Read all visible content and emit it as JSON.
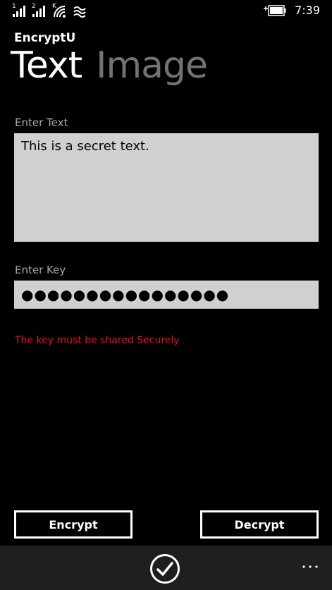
{
  "status_bar": {
    "sim1_label": "1",
    "sim2_label": "2",
    "data_indicator": "K",
    "time": "7:39",
    "icons": [
      "signal-bars-icon",
      "signal-bars-icon",
      "wifi-icon",
      "vibrate-icon",
      "battery-charging-icon"
    ]
  },
  "app": {
    "title": "EncryptU"
  },
  "pivot": {
    "tabs": [
      {
        "label": "Text",
        "active": true
      },
      {
        "label": "Image",
        "active": false
      }
    ]
  },
  "form": {
    "text_label": "Enter Text",
    "text_value": "This is a secret text.",
    "key_label": "Enter Key",
    "key_value": "●●●●●●●●●●●●●●●●",
    "warning": "The key must be shared Securely"
  },
  "buttons": {
    "encrypt_label": "Encrypt",
    "decrypt_label": "Decrypt"
  },
  "app_bar": {
    "primary_icon": "checkmark-circle-icon",
    "more_icon": "ellipsis-icon"
  },
  "colors": {
    "background": "#000000",
    "field_background": "#d0d0d0",
    "inactive_tab": "#737373",
    "label": "#a6a6a6",
    "warning": "#e5141b",
    "app_bar": "#1f1f1f"
  }
}
